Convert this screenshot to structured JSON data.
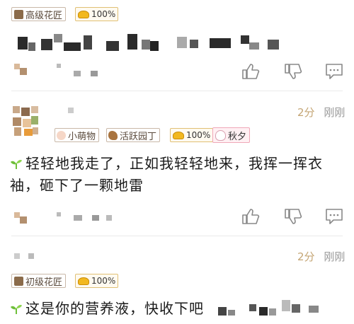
{
  "colors": {
    "accent_time": "#c4a574",
    "badge_border": "#c9b8a8",
    "gold": "#f2b81f",
    "leaf": "#6fbf3a",
    "divider": "#eaeaea"
  },
  "top_user": {
    "level_badge": "高级花匠",
    "gold_badge": "100%"
  },
  "comment1": {
    "time": "2分",
    "status": "刚刚",
    "badges": [
      "小萌物",
      "活跃园丁",
      "100%",
      "秋夕"
    ],
    "text_line1": "轻轻地我走了，正如我轻轻地来，我挥一挥衣",
    "text_line2": "袖，砸下了一颗地雷"
  },
  "comment2": {
    "time": "2分",
    "status": "刚刚",
    "level_badge": "初级花匠",
    "gold_badge": "100%",
    "text": "这是你的营养液，快收下吧"
  },
  "icons": [
    "thumbs-up-icon",
    "thumbs-down-icon",
    "reply-bubble-icon",
    "sprout-icon",
    "gold-ingot-icon",
    "rabbit-icon",
    "paw-icon",
    "squirrel-icon"
  ]
}
